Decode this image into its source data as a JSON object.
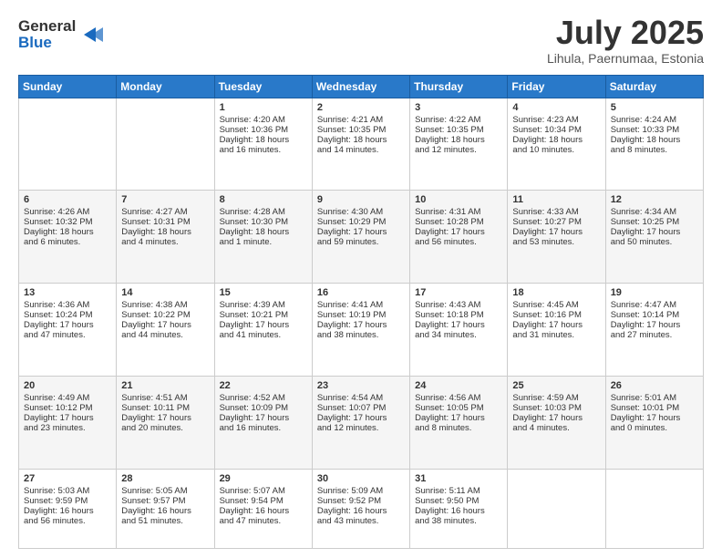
{
  "header": {
    "logo_line1": "General",
    "logo_line2": "Blue",
    "month": "July 2025",
    "location": "Lihula, Paernumaa, Estonia"
  },
  "days_of_week": [
    "Sunday",
    "Monday",
    "Tuesday",
    "Wednesday",
    "Thursday",
    "Friday",
    "Saturday"
  ],
  "weeks": [
    [
      {
        "day": "",
        "info": ""
      },
      {
        "day": "",
        "info": ""
      },
      {
        "day": "1",
        "info": "Sunrise: 4:20 AM\nSunset: 10:36 PM\nDaylight: 18 hours\nand 16 minutes."
      },
      {
        "day": "2",
        "info": "Sunrise: 4:21 AM\nSunset: 10:35 PM\nDaylight: 18 hours\nand 14 minutes."
      },
      {
        "day": "3",
        "info": "Sunrise: 4:22 AM\nSunset: 10:35 PM\nDaylight: 18 hours\nand 12 minutes."
      },
      {
        "day": "4",
        "info": "Sunrise: 4:23 AM\nSunset: 10:34 PM\nDaylight: 18 hours\nand 10 minutes."
      },
      {
        "day": "5",
        "info": "Sunrise: 4:24 AM\nSunset: 10:33 PM\nDaylight: 18 hours\nand 8 minutes."
      }
    ],
    [
      {
        "day": "6",
        "info": "Sunrise: 4:26 AM\nSunset: 10:32 PM\nDaylight: 18 hours\nand 6 minutes."
      },
      {
        "day": "7",
        "info": "Sunrise: 4:27 AM\nSunset: 10:31 PM\nDaylight: 18 hours\nand 4 minutes."
      },
      {
        "day": "8",
        "info": "Sunrise: 4:28 AM\nSunset: 10:30 PM\nDaylight: 18 hours\nand 1 minute."
      },
      {
        "day": "9",
        "info": "Sunrise: 4:30 AM\nSunset: 10:29 PM\nDaylight: 17 hours\nand 59 minutes."
      },
      {
        "day": "10",
        "info": "Sunrise: 4:31 AM\nSunset: 10:28 PM\nDaylight: 17 hours\nand 56 minutes."
      },
      {
        "day": "11",
        "info": "Sunrise: 4:33 AM\nSunset: 10:27 PM\nDaylight: 17 hours\nand 53 minutes."
      },
      {
        "day": "12",
        "info": "Sunrise: 4:34 AM\nSunset: 10:25 PM\nDaylight: 17 hours\nand 50 minutes."
      }
    ],
    [
      {
        "day": "13",
        "info": "Sunrise: 4:36 AM\nSunset: 10:24 PM\nDaylight: 17 hours\nand 47 minutes."
      },
      {
        "day": "14",
        "info": "Sunrise: 4:38 AM\nSunset: 10:22 PM\nDaylight: 17 hours\nand 44 minutes."
      },
      {
        "day": "15",
        "info": "Sunrise: 4:39 AM\nSunset: 10:21 PM\nDaylight: 17 hours\nand 41 minutes."
      },
      {
        "day": "16",
        "info": "Sunrise: 4:41 AM\nSunset: 10:19 PM\nDaylight: 17 hours\nand 38 minutes."
      },
      {
        "day": "17",
        "info": "Sunrise: 4:43 AM\nSunset: 10:18 PM\nDaylight: 17 hours\nand 34 minutes."
      },
      {
        "day": "18",
        "info": "Sunrise: 4:45 AM\nSunset: 10:16 PM\nDaylight: 17 hours\nand 31 minutes."
      },
      {
        "day": "19",
        "info": "Sunrise: 4:47 AM\nSunset: 10:14 PM\nDaylight: 17 hours\nand 27 minutes."
      }
    ],
    [
      {
        "day": "20",
        "info": "Sunrise: 4:49 AM\nSunset: 10:12 PM\nDaylight: 17 hours\nand 23 minutes."
      },
      {
        "day": "21",
        "info": "Sunrise: 4:51 AM\nSunset: 10:11 PM\nDaylight: 17 hours\nand 20 minutes."
      },
      {
        "day": "22",
        "info": "Sunrise: 4:52 AM\nSunset: 10:09 PM\nDaylight: 17 hours\nand 16 minutes."
      },
      {
        "day": "23",
        "info": "Sunrise: 4:54 AM\nSunset: 10:07 PM\nDaylight: 17 hours\nand 12 minutes."
      },
      {
        "day": "24",
        "info": "Sunrise: 4:56 AM\nSunset: 10:05 PM\nDaylight: 17 hours\nand 8 minutes."
      },
      {
        "day": "25",
        "info": "Sunrise: 4:59 AM\nSunset: 10:03 PM\nDaylight: 17 hours\nand 4 minutes."
      },
      {
        "day": "26",
        "info": "Sunrise: 5:01 AM\nSunset: 10:01 PM\nDaylight: 17 hours\nand 0 minutes."
      }
    ],
    [
      {
        "day": "27",
        "info": "Sunrise: 5:03 AM\nSunset: 9:59 PM\nDaylight: 16 hours\nand 56 minutes."
      },
      {
        "day": "28",
        "info": "Sunrise: 5:05 AM\nSunset: 9:57 PM\nDaylight: 16 hours\nand 51 minutes."
      },
      {
        "day": "29",
        "info": "Sunrise: 5:07 AM\nSunset: 9:54 PM\nDaylight: 16 hours\nand 47 minutes."
      },
      {
        "day": "30",
        "info": "Sunrise: 5:09 AM\nSunset: 9:52 PM\nDaylight: 16 hours\nand 43 minutes."
      },
      {
        "day": "31",
        "info": "Sunrise: 5:11 AM\nSunset: 9:50 PM\nDaylight: 16 hours\nand 38 minutes."
      },
      {
        "day": "",
        "info": ""
      },
      {
        "day": "",
        "info": ""
      }
    ]
  ]
}
